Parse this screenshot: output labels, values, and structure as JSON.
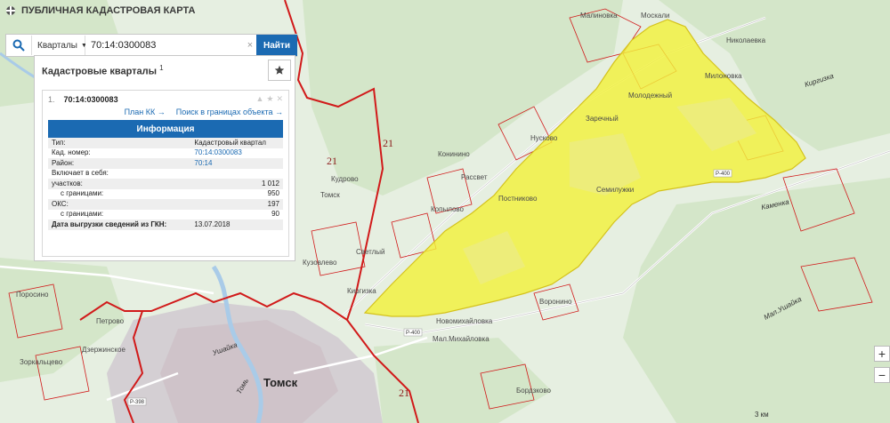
{
  "app": {
    "title": "ПУБЛИЧНАЯ КАДАСТРОВАЯ КАРТА"
  },
  "search": {
    "type_label": "Кварталы",
    "query": "70:14:0300083",
    "button_label": "Найти",
    "clear_label": "×"
  },
  "results": {
    "title": "Кадастровые кварталы",
    "count": "1",
    "item_number": "1.",
    "item_id": "70:14:0300083",
    "link_plan": "План КК →",
    "link_search": "Поиск в границах объекта →",
    "info_title": "Информация",
    "rows": [
      {
        "label": "Тип:",
        "value": "Кадастровый квартал"
      },
      {
        "label": "Кад. номер:",
        "value": "70:14:0300083"
      },
      {
        "label": "Район:",
        "value": "70:14"
      },
      {
        "label": "Включает в себя:",
        "value": ""
      },
      {
        "label": "участков:",
        "value": "1 012"
      },
      {
        "label": "с границами:",
        "value": "950"
      },
      {
        "label": "ОКС:",
        "value": "197"
      },
      {
        "label": "с границами:",
        "value": "90"
      },
      {
        "label": "Дата выгрузки сведений из ГКН:",
        "value": "13.07.2018"
      }
    ]
  },
  "map": {
    "places": {
      "tomsk": "Томск",
      "moskali": "Москали",
      "malinovka": "Малиновка",
      "nikolaevka": "Николаевка",
      "molodezhny": "Молодежный",
      "milyonovka": "Милоновка",
      "zarechny": "Заречный",
      "nuskovo": "Нусково",
      "konininino": "Конинино",
      "rassvet": "Рассвет",
      "kudrovo": "Кудрово",
      "tomsk_small": "Томск",
      "kopylovo": "Копылово",
      "postnikovo": "Постниково",
      "semiluzhki": "Семилужки",
      "svetly": "Светлый",
      "kuzovlevo": "Кузовлево",
      "kirgizka": "Киргизка",
      "voronino": "Воронино",
      "novomikhaylovka": "Новомихайловка",
      "mal_mikhaylovka": "Мал.Михайловка",
      "porosino": "Поросино",
      "petrovo": "Петрово",
      "dzerzhinskoe": "Дзержинское",
      "zorkaltsevo": "Зоркальцево",
      "borzhkovo": "Бордзково",
      "kirgizka_river": "Киргизка",
      "kamenka": "Каменка",
      "mal_ushayka": "Мал.Ушайка",
      "ushayka": "Ушайка",
      "tom": "Томь"
    },
    "districts": [
      "21",
      "21",
      "21"
    ],
    "roads": [
      "Р-400",
      "Р-400",
      "Р-398"
    ],
    "colors": {
      "parcel_fill": "#f2f23c",
      "parcel_stroke": "#d4c21c",
      "boundary": "#d11a1a",
      "accent": "#1b6ab2",
      "forest": "#d4e6c9",
      "ground": "#e6efe1",
      "city": "#d4cfd3"
    },
    "zoom_in": "+",
    "zoom_out": "−",
    "scale": "3 км"
  }
}
